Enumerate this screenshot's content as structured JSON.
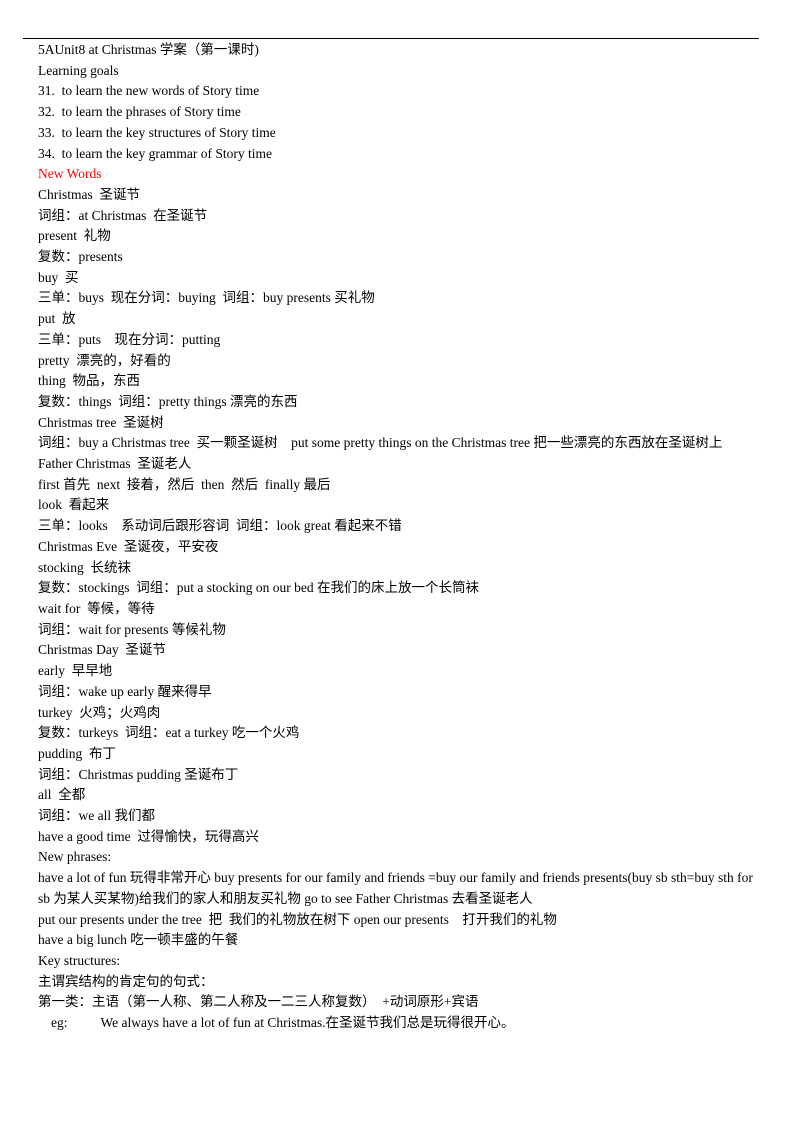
{
  "title": "5AUnit8 at Christmas 学案（第一课时)",
  "learning_goals_heading": "Learning goals",
  "learning_goals": [
    "31.  to learn the new words of Story time",
    "32.  to learn the phrases of Story time",
    "33.  to learn the key structures of Story time",
    "34.  to learn the key grammar of Story time"
  ],
  "new_words_heading": "New Words",
  "new_words_heading_color": "#ff0000",
  "new_words": [
    "Christmas  圣诞节",
    "词组：at Christmas  在圣诞节",
    "present  礼物",
    "复数：presents",
    "buy  买",
    "三单：buys  现在分词：buying  词组：buy presents 买礼物",
    "put  放",
    "三单：puts    现在分词：putting",
    "pretty  漂亮的，好看的",
    "thing  物品，东西",
    "复数：things  词组：pretty things 漂亮的东西",
    "Christmas tree  圣诞树",
    "词组：buy a Christmas tree  买一颗圣诞树    put some pretty things on the Christmas tree 把一些漂亮的东西放在圣诞树上",
    "Father Christmas  圣诞老人",
    "first 首先  next  接着，然后  then  然后  finally 最后",
    "look  看起来",
    "三单：looks    系动词后跟形容词  词组：look great 看起来不错",
    "Christmas Eve  圣诞夜，平安夜",
    "stocking  长统袜",
    "复数：stockings  词组：put a stocking on our bed 在我们的床上放一个长筒袜",
    "wait for  等候，等待",
    "词组：wait for presents 等候礼物",
    "Christmas Day  圣诞节",
    "early  早早地",
    "词组：wake up early 醒来得早",
    "turkey  火鸡；火鸡肉",
    "复数：turkeys  词组：eat a turkey 吃一个火鸡",
    "pudding  布丁",
    "词组：Christmas pudding 圣诞布丁",
    "all  全都",
    "词组：we all 我们都",
    "have a good time  过得愉快，玩得高兴"
  ],
  "new_phrases_heading": "New phrases:",
  "new_phrases": [
    "have a lot of fun  玩得非常开心  buy presents for our family and friends =buy our family and friends presents(buy sb sth=buy sth for sb 为某人买某物)给我们的家人和朋友买礼物    go to see Father Christmas  去看圣诞老人",
    "put our presents under the tree  把  我们的礼物放在树下 open our presents    打开我们的礼物",
    "have a big lunch 吃一顿丰盛的午餐"
  ],
  "key_structures_heading": "Key structures:",
  "key_structures": [
    "主谓宾结构的肯定句的句式：",
    "第一类：主语（第一人称、第二人称及一二三人称复数）  +动词原形+宾语"
  ],
  "example": {
    "label": "eg:",
    "text": "We always have a lot of fun at Christmas.在圣诞节我们总是玩得很开心。"
  }
}
